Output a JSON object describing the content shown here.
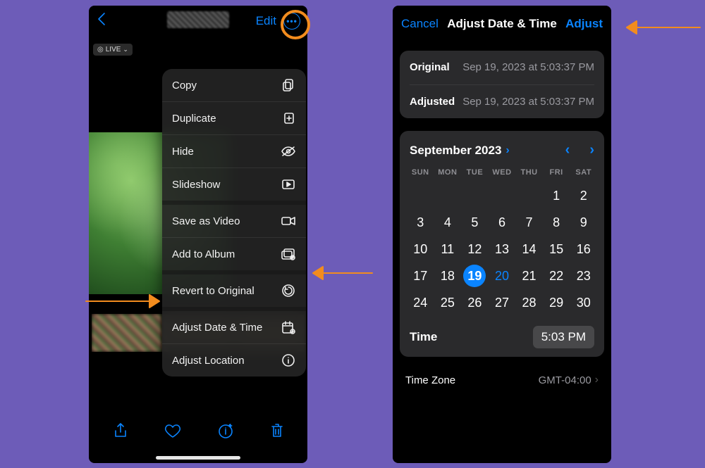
{
  "left": {
    "nav": {
      "edit_label": "Edit",
      "live_label": "LIVE"
    },
    "menu": [
      {
        "label": "Copy",
        "icon": "copy-icon"
      },
      {
        "label": "Duplicate",
        "icon": "duplicate-icon"
      },
      {
        "label": "Hide",
        "icon": "hide-icon"
      },
      {
        "label": "Slideshow",
        "icon": "slideshow-icon"
      },
      {
        "label": "Save as Video",
        "icon": "video-icon"
      },
      {
        "label": "Add to Album",
        "icon": "add-album-icon"
      },
      {
        "label": "Revert to Original",
        "icon": "revert-icon"
      },
      {
        "label": "Adjust Date & Time",
        "icon": "calendar-icon"
      },
      {
        "label": "Adjust Location",
        "icon": "info-icon"
      }
    ]
  },
  "right": {
    "nav": {
      "cancel": "Cancel",
      "title": "Adjust Date & Time",
      "apply": "Adjust"
    },
    "info": {
      "original_label": "Original",
      "original_value": "Sep 19, 2023 at 5:03:37 PM",
      "adjusted_label": "Adjusted",
      "adjusted_value": "Sep 19, 2023 at 5:03:37 PM"
    },
    "calendar": {
      "month_label": "September 2023",
      "dow": [
        "SUN",
        "MON",
        "TUE",
        "WED",
        "THU",
        "FRI",
        "SAT"
      ],
      "leading_blanks": 5,
      "days": 30,
      "selected": 19,
      "today": 20
    },
    "time": {
      "label": "Time",
      "value": "5:03 PM"
    },
    "timezone": {
      "label": "Time Zone",
      "value": "GMT-04:00"
    }
  }
}
